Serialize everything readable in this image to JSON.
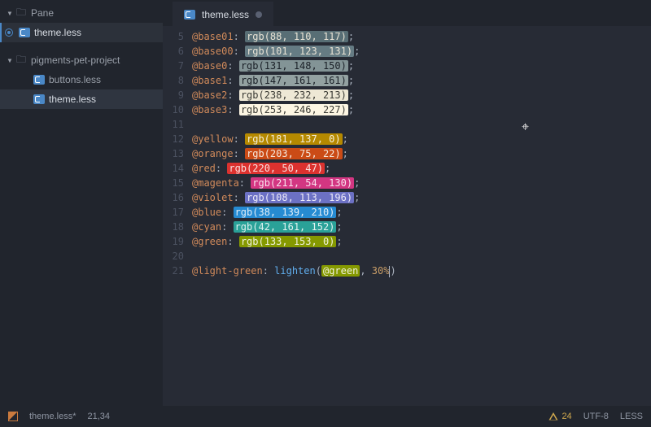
{
  "sidebar": {
    "pane_label": "Pane",
    "open_file": "theme.less",
    "project_label": "pigments-pet-project",
    "files": [
      {
        "name": "buttons.less"
      },
      {
        "name": "theme.less"
      }
    ]
  },
  "tab": {
    "title": "theme.less",
    "modified": true
  },
  "gutter_start": 5,
  "code_lines": [
    {
      "var": "@base01",
      "func": "rgb",
      "args": [
        88,
        110,
        117
      ],
      "swatch_bg": "#586e75",
      "swatch_fg": "#e8e3d5"
    },
    {
      "var": "@base00",
      "func": "rgb",
      "args": [
        101,
        123,
        131
      ],
      "swatch_bg": "#657b83",
      "swatch_fg": "#e8e3d5"
    },
    {
      "var": "@base0",
      "func": "rgb",
      "args": [
        131,
        148,
        150
      ],
      "swatch_bg": "#839496",
      "swatch_fg": "#1b2128"
    },
    {
      "var": "@base1",
      "func": "rgb",
      "args": [
        147,
        161,
        161
      ],
      "swatch_bg": "#93a1a1",
      "swatch_fg": "#1b2128"
    },
    {
      "var": "@base2",
      "func": "rgb",
      "args": [
        238,
        232,
        213
      ],
      "swatch_bg": "#eee8d5",
      "swatch_fg": "#3a3a34"
    },
    {
      "var": "@base3",
      "func": "rgb",
      "args": [
        253,
        246,
        227
      ],
      "swatch_bg": "#fdf6e3",
      "swatch_fg": "#3a3a34"
    },
    {
      "blank": true
    },
    {
      "var": "@yellow",
      "func": "rgb",
      "args": [
        181,
        137,
        0
      ],
      "swatch_bg": "#b58900",
      "swatch_fg": "#f5efda"
    },
    {
      "var": "@orange",
      "func": "rgb",
      "args": [
        203,
        75,
        22
      ],
      "swatch_bg": "#cb4b16",
      "swatch_fg": "#f5e8dd"
    },
    {
      "var": "@red",
      "func": "rgb",
      "args": [
        220,
        50,
        47
      ],
      "swatch_bg": "#dc322f",
      "swatch_fg": "#fae2e0"
    },
    {
      "var": "@magenta",
      "func": "rgb",
      "args": [
        211,
        54,
        130
      ],
      "swatch_bg": "#d33682",
      "swatch_fg": "#f9e1ed"
    },
    {
      "var": "@violet",
      "func": "rgb",
      "args": [
        108,
        113,
        196
      ],
      "swatch_bg": "#6c71c4",
      "swatch_fg": "#eceaf7"
    },
    {
      "var": "@blue",
      "func": "rgb",
      "args": [
        38,
        139,
        210
      ],
      "swatch_bg": "#268bd2",
      "swatch_fg": "#e0eef8"
    },
    {
      "var": "@cyan",
      "func": "rgb",
      "args": [
        42,
        161,
        152
      ],
      "swatch_bg": "#2aa198",
      "swatch_fg": "#e0f2f0"
    },
    {
      "var": "@green",
      "func": "rgb",
      "args": [
        133,
        153,
        0
      ],
      "swatch_bg": "#859900",
      "swatch_fg": "#f0f2db"
    },
    {
      "blank": true
    },
    {
      "var": "@light-green",
      "func": "lighten",
      "ref": "@green",
      "pct": "30%",
      "ref_bg": "#859900",
      "ref_fg": "#f0f2db"
    }
  ],
  "statusbar": {
    "file": "theme.less*",
    "pos": "21,34",
    "warn_count": "24",
    "encoding": "UTF-8",
    "grammar": "LESS"
  }
}
